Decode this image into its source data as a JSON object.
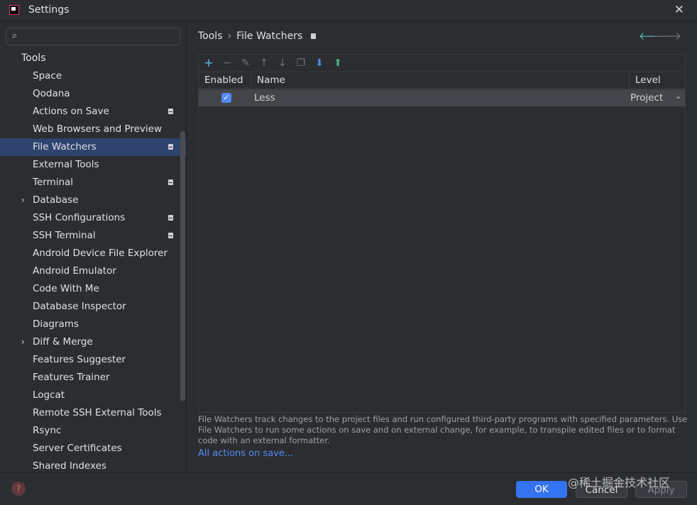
{
  "window": {
    "title": "Settings",
    "close_icon": "✕"
  },
  "sidebar": {
    "search": {
      "placeholder": "",
      "value": ""
    },
    "group_label": "Tools",
    "items": [
      {
        "label": "Space",
        "badge": false,
        "expandable": false,
        "selected": false
      },
      {
        "label": "Qodana",
        "badge": false,
        "expandable": false,
        "selected": false
      },
      {
        "label": "Actions on Save",
        "badge": true,
        "expandable": false,
        "selected": false
      },
      {
        "label": "Web Browsers and Preview",
        "badge": false,
        "expandable": false,
        "selected": false
      },
      {
        "label": "File Watchers",
        "badge": true,
        "expandable": false,
        "selected": true
      },
      {
        "label": "External Tools",
        "badge": false,
        "expandable": false,
        "selected": false
      },
      {
        "label": "Terminal",
        "badge": true,
        "expandable": false,
        "selected": false
      },
      {
        "label": "Database",
        "badge": false,
        "expandable": true,
        "selected": false
      },
      {
        "label": "SSH Configurations",
        "badge": true,
        "expandable": false,
        "selected": false
      },
      {
        "label": "SSH Terminal",
        "badge": true,
        "expandable": false,
        "selected": false
      },
      {
        "label": "Android Device File Explorer",
        "badge": false,
        "expandable": false,
        "selected": false
      },
      {
        "label": "Android Emulator",
        "badge": false,
        "expandable": false,
        "selected": false
      },
      {
        "label": "Code With Me",
        "badge": false,
        "expandable": false,
        "selected": false
      },
      {
        "label": "Database Inspector",
        "badge": false,
        "expandable": false,
        "selected": false
      },
      {
        "label": "Diagrams",
        "badge": false,
        "expandable": false,
        "selected": false
      },
      {
        "label": "Diff & Merge",
        "badge": false,
        "expandable": true,
        "selected": false
      },
      {
        "label": "Features Suggester",
        "badge": false,
        "expandable": false,
        "selected": false
      },
      {
        "label": "Features Trainer",
        "badge": false,
        "expandable": false,
        "selected": false
      },
      {
        "label": "Logcat",
        "badge": false,
        "expandable": false,
        "selected": false
      },
      {
        "label": "Remote SSH External Tools",
        "badge": false,
        "expandable": false,
        "selected": false
      },
      {
        "label": "Rsync",
        "badge": false,
        "expandable": false,
        "selected": false
      },
      {
        "label": "Server Certificates",
        "badge": false,
        "expandable": false,
        "selected": false
      },
      {
        "label": "Shared Indexes",
        "badge": false,
        "expandable": false,
        "selected": false
      }
    ]
  },
  "main": {
    "breadcrumb": {
      "parent": "Tools",
      "separator": "›",
      "current": "File Watchers"
    },
    "nav": {
      "back_icon": "🡐",
      "forward_icon": "🡒"
    },
    "toolbar_icons": [
      "add-icon",
      "remove-icon",
      "edit-icon",
      "move-up-icon",
      "move-down-icon",
      "copy-icon",
      "import-icon",
      "export-icon"
    ],
    "table": {
      "columns": {
        "enabled": "Enabled",
        "name": "Name",
        "level": "Level"
      },
      "rows": [
        {
          "enabled": true,
          "name": "Less",
          "level": "Project"
        }
      ]
    },
    "description": "File Watchers track changes to the project files and run configured third-party programs with specified parameters. Use File Watchers to run some actions on save and on external change, for example, to transpile edited files or to format code with an external formatter.",
    "link": "All actions on save..."
  },
  "footer": {
    "help_icon": "?",
    "ok": "OK",
    "cancel": "Cancel",
    "apply": "Apply",
    "watermark": "@稀土掘金技术社区"
  },
  "colors": {
    "background": "#2b2d30",
    "selection": "#2e436e",
    "accent": "#3574f0",
    "link": "#548af7"
  }
}
